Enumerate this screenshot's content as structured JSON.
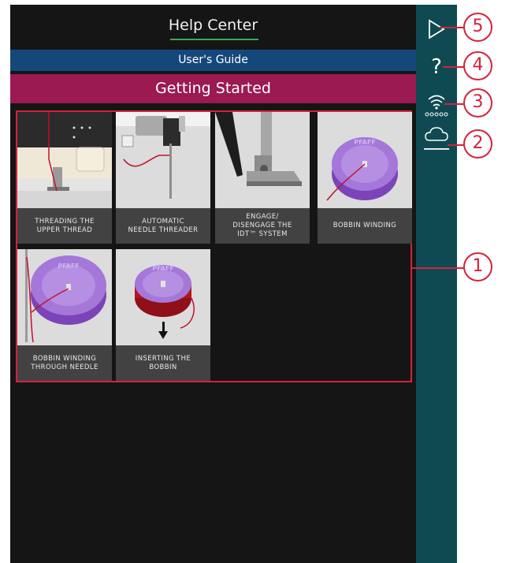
{
  "header": {
    "title": "Help Center"
  },
  "guide_bar": {
    "label": "User's Guide"
  },
  "section_bar": {
    "label": "Getting Started"
  },
  "tiles": [
    {
      "caption": "THREADING THE\nUPPER THREAD"
    },
    {
      "caption": "AUTOMATIC\nNEEDLE THREADER"
    },
    {
      "caption": "ENGAGE/\nDISENGAGE THE\nIDT™ SYSTEM"
    },
    {
      "caption": "BOBBIN WINDING"
    },
    {
      "caption": "BOBBIN WINDING\nTHROUGH NEEDLE"
    },
    {
      "caption": "INSERTING THE\nBOBBIN"
    }
  ],
  "bobbin_brand": "PFAFF",
  "sidebar": {
    "icons": [
      "play-icon",
      "help-icon",
      "wifi-icon",
      "cloud-icon"
    ],
    "help_glyph": "?"
  },
  "callouts": {
    "numbers": [
      "5",
      "4",
      "3",
      "2",
      "1"
    ]
  },
  "colors": {
    "screen_bg": "#151515",
    "sidebar_bg": "#0f4a52",
    "guide_bar": "#15487a",
    "section_bar": "#9b1a52",
    "title_underline": "#3ea84f",
    "callout_red": "#d2233c"
  }
}
